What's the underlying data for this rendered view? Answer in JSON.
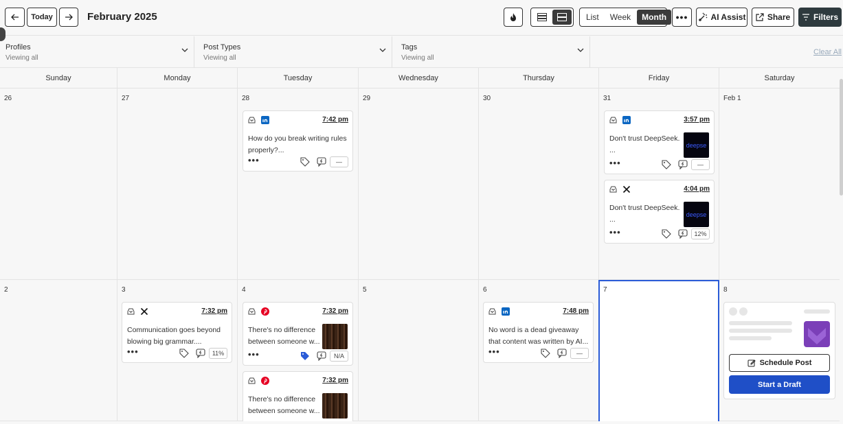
{
  "header": {
    "today_label": "Today",
    "title": "February 2025",
    "views": [
      "List",
      "Week",
      "Month"
    ],
    "active_view": "Month",
    "ai_label": "AI Assist",
    "share_label": "Share",
    "filters_label": "Filters"
  },
  "filters": [
    {
      "label": "Profiles",
      "value": "Viewing all"
    },
    {
      "label": "Post Types",
      "value": "Viewing all"
    },
    {
      "label": "Tags",
      "value": "Viewing all"
    }
  ],
  "clear_all": "Clear All",
  "weekdays": [
    "Sunday",
    "Monday",
    "Tuesday",
    "Wednesday",
    "Thursday",
    "Friday",
    "Saturday"
  ],
  "week1_dates": [
    "26",
    "27",
    "28",
    "29",
    "30",
    "31",
    "Feb 1"
  ],
  "week2_dates": [
    "2",
    "3",
    "4",
    "5",
    "6",
    "7",
    "8"
  ],
  "posts": {
    "tue28": {
      "network": "linkedin",
      "time": "7:42 pm",
      "text1": "How do you break writing rules",
      "text2": "properly?...",
      "score": "—"
    },
    "fri31a": {
      "network": "linkedin",
      "time": "3:57 pm",
      "text1": "Don't trust DeepSeek.",
      "text2": "...",
      "thumb": "deepse",
      "score": "—"
    },
    "fri31b": {
      "network": "x",
      "time": "4:04 pm",
      "text1": "Don't trust DeepSeek.",
      "text2": "...",
      "thumb": "deepse",
      "score": "12%"
    },
    "mon3": {
      "network": "x",
      "time": "7:32 pm",
      "text1": "Communication goes beyond",
      "text2": "blowing big grammar....",
      "score": "11%"
    },
    "tue4a": {
      "network": "pinterest",
      "time": "7:32 pm",
      "text1": "There's no difference",
      "text2": "between someone w...",
      "score": "N/A"
    },
    "tue4b": {
      "network": "pinterest",
      "time": "7:32 pm",
      "text1": "There's no difference",
      "text2": "between someone w..."
    },
    "thu6": {
      "network": "linkedin",
      "time": "7:48 pm",
      "text1": "No word is a dead giveaway",
      "text2": "that content was written by AI...",
      "score": "—"
    }
  },
  "empty_day": {
    "schedule_label": "Schedule Post",
    "draft_label": "Start a Draft"
  },
  "colors": {
    "today_border": "#2a5bd7",
    "primary_button": "#1f4fc7",
    "linkedin": "#0a66c2",
    "pinterest": "#e60023",
    "tag_active": "#2a5bd7"
  }
}
